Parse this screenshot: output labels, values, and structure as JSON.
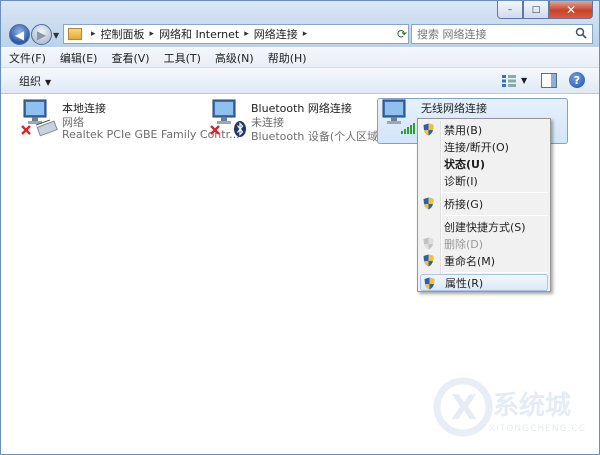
{
  "window": {
    "controls": {
      "minimize": "–",
      "maximize": "□",
      "close": "✕"
    }
  },
  "nav": {
    "back": "◀",
    "forward": "▶",
    "breadcrumbs": [
      "控制面板",
      "网络和 Internet",
      "网络连接"
    ],
    "separator": "▸"
  },
  "search": {
    "placeholder": "搜索 网络连接"
  },
  "menubar": {
    "items": [
      "文件(F)",
      "编辑(E)",
      "查看(V)",
      "工具(T)",
      "高级(N)",
      "帮助(H)"
    ]
  },
  "cmdbar": {
    "organize": "组织",
    "caret": "▼"
  },
  "connections": [
    {
      "name": "本地连接",
      "status": "网络",
      "device": "Realtek PCIe GBE Family Contr..."
    },
    {
      "name": "Bluetooth 网络连接",
      "status": "未连接",
      "device": "Bluetooth 设备(个人区域网)"
    },
    {
      "name": "无线网络连接",
      "status": "",
      "device": ""
    }
  ],
  "context_menu": {
    "items": [
      {
        "label": "禁用(B)",
        "shield": true,
        "style": ""
      },
      {
        "label": "连接/断开(O)",
        "shield": false,
        "style": ""
      },
      {
        "label": "状态(U)",
        "shield": false,
        "style": "bold"
      },
      {
        "label": "诊断(I)",
        "shield": false,
        "style": ""
      },
      {
        "label": "桥接(G)",
        "shield": true,
        "style": ""
      },
      {
        "label": "创建快捷方式(S)",
        "shield": false,
        "style": ""
      },
      {
        "label": "删除(D)",
        "shield": true,
        "style": "disabled"
      },
      {
        "label": "重命名(M)",
        "shield": true,
        "style": ""
      },
      {
        "label": "属性(R)",
        "shield": true,
        "style": "hover"
      }
    ]
  },
  "watermark": {
    "main": "系统城",
    "sub": "XITONGCHENG.CC"
  },
  "colors": {
    "accent": "#2c5aa8",
    "selection": "#d2e5fa",
    "error_x": "#d8262a",
    "signal_green": "#2aa32a"
  }
}
